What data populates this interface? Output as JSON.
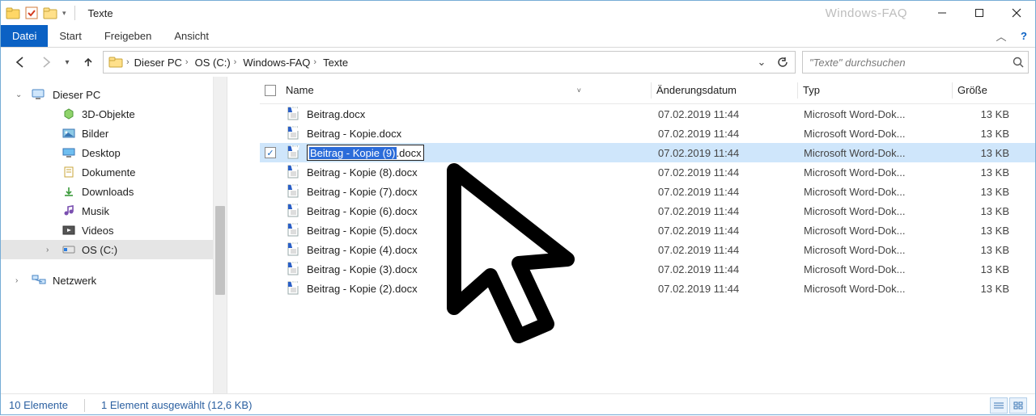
{
  "window": {
    "title": "Texte",
    "watermark": "Windows-FAQ"
  },
  "ribbon": {
    "file": "Datei",
    "tabs": [
      "Start",
      "Freigeben",
      "Ansicht"
    ]
  },
  "nav": {
    "breadcrumbs": [
      "Dieser PC",
      "OS (C:)",
      "Windows-FAQ",
      "Texte"
    ]
  },
  "search": {
    "placeholder": "\"Texte\" durchsuchen"
  },
  "tree": {
    "root": "Dieser PC",
    "children": [
      "3D-Objekte",
      "Bilder",
      "Desktop",
      "Dokumente",
      "Downloads",
      "Musik",
      "Videos",
      "OS (C:)"
    ],
    "selected": "OS (C:)",
    "network": "Netzwerk"
  },
  "columns": {
    "name": "Name",
    "date": "Änderungsdatum",
    "type": "Typ",
    "size": "Größe"
  },
  "files": [
    {
      "name": "Beitrag.docx",
      "date": "07.02.2019 11:44",
      "type": "Microsoft Word-Dok...",
      "size": "13 KB"
    },
    {
      "name": "Beitrag - Kopie.docx",
      "date": "07.02.2019 11:44",
      "type": "Microsoft Word-Dok...",
      "size": "13 KB"
    },
    {
      "name": "Beitrag - Kopie (9).docx",
      "date": "07.02.2019 11:44",
      "type": "Microsoft Word-Dok...",
      "size": "13 KB",
      "selected": true,
      "rename": {
        "selected": "Beitrag - Kopie (9)",
        "rest": ".docx"
      }
    },
    {
      "name": "Beitrag - Kopie (8).docx",
      "date": "07.02.2019 11:44",
      "type": "Microsoft Word-Dok...",
      "size": "13 KB"
    },
    {
      "name": "Beitrag - Kopie (7).docx",
      "date": "07.02.2019 11:44",
      "type": "Microsoft Word-Dok...",
      "size": "13 KB"
    },
    {
      "name": "Beitrag - Kopie (6).docx",
      "date": "07.02.2019 11:44",
      "type": "Microsoft Word-Dok...",
      "size": "13 KB"
    },
    {
      "name": "Beitrag - Kopie (5).docx",
      "date": "07.02.2019 11:44",
      "type": "Microsoft Word-Dok...",
      "size": "13 KB"
    },
    {
      "name": "Beitrag - Kopie (4).docx",
      "date": "07.02.2019 11:44",
      "type": "Microsoft Word-Dok...",
      "size": "13 KB"
    },
    {
      "name": "Beitrag - Kopie (3).docx",
      "date": "07.02.2019 11:44",
      "type": "Microsoft Word-Dok...",
      "size": "13 KB"
    },
    {
      "name": "Beitrag - Kopie (2).docx",
      "date": "07.02.2019 11:44",
      "type": "Microsoft Word-Dok...",
      "size": "13 KB"
    }
  ],
  "status": {
    "count": "10 Elemente",
    "selection": "1 Element ausgewählt (12,6 KB)"
  },
  "colors": {
    "accent": "#0b61c4",
    "selection": "#cfe6fb"
  }
}
